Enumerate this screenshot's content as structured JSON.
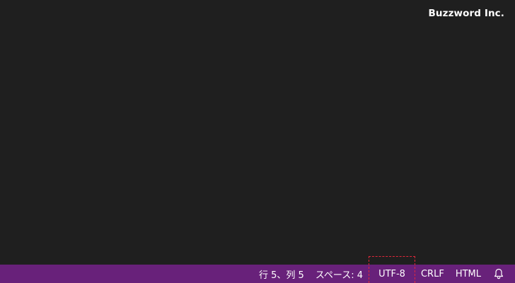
{
  "watermark": "Buzzword Inc.",
  "statusbar": {
    "cursor_position": "行 5、列 5",
    "indentation": "スペース: 4",
    "encoding": "UTF-8",
    "line_ending": "CRLF",
    "language_mode": "HTML",
    "notifications_icon": "bell-icon",
    "background_color": "#68217a",
    "highlight_color": "#e0283a"
  },
  "editor": {
    "background_color": "#1f1f1f"
  }
}
